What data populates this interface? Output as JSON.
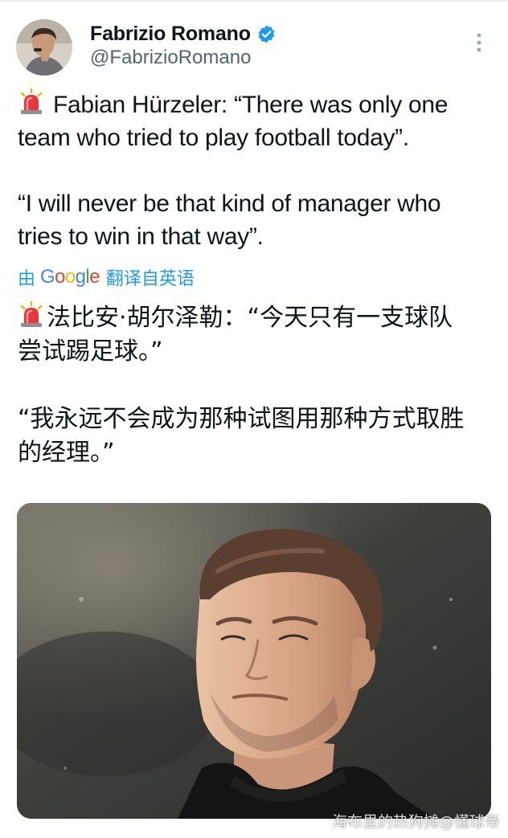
{
  "author": {
    "display_name": "Fabrizio Romano",
    "handle": "@FabrizioRomano",
    "verified": true,
    "verified_color": "#1d9bf0"
  },
  "tweet": {
    "lines_en": [
      "Fabian Hürzeler: “There was only one",
      "team who tried to play football today”.",
      "“I will never be that kind of manager who",
      "tries to win in that way”."
    ],
    "emoji": "police-car-light"
  },
  "translation": {
    "prefix": "由",
    "provider": "Google",
    "suffix": "翻译自英语",
    "lines_zh": [
      "法比安·胡尔泽勒：“今天只有一支球队",
      "尝试踢足球。”",
      "“我永远不会成为那种试图用那种方式取胜",
      "的经理。”"
    ]
  },
  "media": {
    "type": "photo"
  },
  "watermark": "海布里的热狗摊@懂球帝",
  "colors": {
    "text": "#0f1419",
    "secondary": "#536471",
    "accent": "#1d9bf0"
  }
}
